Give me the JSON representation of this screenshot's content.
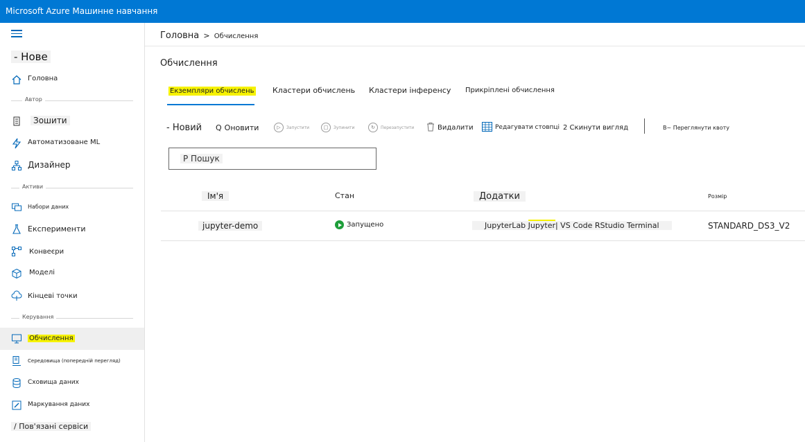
{
  "app": {
    "title": "Microsoft Azure Машинне навчання"
  },
  "sidebar": {
    "new_label": "- Нове",
    "sections": {
      "author": "Автор",
      "assets": "Активи",
      "manage": "Керування"
    },
    "items": [
      {
        "label": "Головна",
        "icon": "home-icon"
      },
      {
        "label": "Зошити",
        "icon": "notebook-icon"
      },
      {
        "label": "Автоматизоване ML",
        "icon": "automl-icon"
      },
      {
        "label": "Дизайнер",
        "icon": "designer-icon"
      },
      {
        "label": "Набори даних",
        "icon": "datasets-icon"
      },
      {
        "label": "Експерименти",
        "icon": "experiments-icon"
      },
      {
        "label": "Конвеєри",
        "icon": "pipelines-icon"
      },
      {
        "label": "Моделі",
        "icon": "models-icon"
      },
      {
        "label": "Кінцеві точки",
        "icon": "endpoints-icon"
      },
      {
        "label": "Обчислення",
        "icon": "compute-icon"
      },
      {
        "label": "Середовища (попередній перегляд)",
        "icon": "environments-icon"
      },
      {
        "label": "Сховища даних",
        "icon": "datastores-icon"
      },
      {
        "label": "Маркування даних",
        "icon": "labeling-icon"
      },
      {
        "label": "/ Пов'язані сервіси",
        "icon": ""
      }
    ]
  },
  "breadcrumb": {
    "home": "Головна",
    "separator": ">",
    "current": "Обчислення"
  },
  "main": {
    "title": "Обчислення",
    "tabs": [
      {
        "label": "Екземпляри обчислень"
      },
      {
        "label": "Кластери обчислень"
      },
      {
        "label": "Кластери інференсу"
      },
      {
        "label": "Прикріплені обчислення"
      }
    ],
    "toolbar": {
      "new": "- Новий",
      "refresh_icon": "Q",
      "refresh": "Оновити",
      "start": "Запустити",
      "stop": "Зупинити",
      "restart": "Перезапустити",
      "delete": "Видалити",
      "edit_columns": "Редагувати стовпці",
      "reset_view": "2 Скинути вигляд",
      "quota": "В~ Переглянути квоту"
    },
    "search": {
      "placeholder": "Р Пошук"
    },
    "table": {
      "headers": {
        "name": "Ім'я",
        "state": "Стан",
        "apps": "Додатки",
        "size": "Розмір"
      },
      "rows": [
        {
          "name": "jupyter-demo",
          "state": "Запущено",
          "apps_a": "JupyterLab ",
          "apps_b": "Jupyter",
          "apps_c": "| VS Code RStudio Terminal",
          "size": "STANDARD_DS3_V2"
        }
      ]
    }
  },
  "colors": {
    "topbar": "#0078d4",
    "highlight": "#f6f200",
    "running": "#1e9e3a"
  }
}
